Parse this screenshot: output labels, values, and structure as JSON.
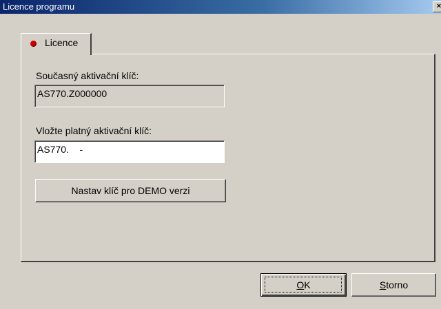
{
  "window": {
    "title": "Licence programu",
    "close_glyph": "×"
  },
  "tab": {
    "label": "Licence",
    "icon": "red-dot-icon",
    "icon_color": "#cc0000"
  },
  "current_key": {
    "label": "Současný aktivační klíč:",
    "value": "AS770.Z000000"
  },
  "new_key": {
    "label": "Vložte platný aktivační klíč:",
    "value": "AS770.    -"
  },
  "demo_button": {
    "label": "Nastav klíč pro DEMO verzi"
  },
  "ok_button": {
    "mnemonic": "O",
    "rest": "K"
  },
  "cancel_button": {
    "mnemonic": "S",
    "rest": "torno"
  }
}
